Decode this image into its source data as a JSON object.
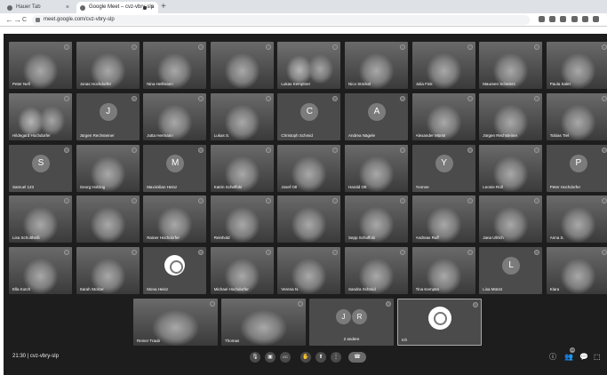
{
  "browser": {
    "tabs": [
      {
        "label": "Hauer Tab",
        "active": false
      },
      {
        "label": "Google Meet – cvz-vbry-slp",
        "active": true
      }
    ],
    "new_tab_glyph": "+",
    "close_glyph": "×",
    "url": "meet.google.com/cvz-vbry-slp",
    "back_glyph": "←",
    "forward_glyph": "→",
    "reload_glyph": "C"
  },
  "participants": [
    {
      "name": "Peter Nell",
      "kind": "photo"
    },
    {
      "name": "Jonas Hochdorfer",
      "kind": "photo"
    },
    {
      "name": "Nina Hellmann",
      "kind": "photo"
    },
    {
      "name": "",
      "kind": "photo"
    },
    {
      "name": "Lukas Kemptner",
      "kind": "photo2"
    },
    {
      "name": "Nico Stöckel",
      "kind": "photo"
    },
    {
      "name": "Julia Fink",
      "kind": "photo"
    },
    {
      "name": "Maureen Scheiers",
      "kind": "photo"
    },
    {
      "name": "Paula Saler",
      "kind": "photo"
    },
    {
      "name": "Hildegard Hochdorfer",
      "kind": "photo2"
    },
    {
      "name": "Jürgen Rechsteiner",
      "kind": "avatar",
      "initial": "J"
    },
    {
      "name": "Jutta Hermann",
      "kind": "photo"
    },
    {
      "name": "Lukas S.",
      "kind": "photo"
    },
    {
      "name": "Christoph Schmid",
      "kind": "avatar",
      "initial": "C"
    },
    {
      "name": "Andrea Nägele",
      "kind": "avatar",
      "initial": "A"
    },
    {
      "name": "Alexander Münst",
      "kind": "photo"
    },
    {
      "name": "Jürgen Rechsteiner",
      "kind": "photo"
    },
    {
      "name": "Tobias Tiel",
      "kind": "photo"
    },
    {
      "name": "Samuel 123",
      "kind": "avatar",
      "initial": "S"
    },
    {
      "name": "Georg Holzing",
      "kind": "photo"
    },
    {
      "name": "Maximilian Heinz",
      "kind": "avatar",
      "initial": "M"
    },
    {
      "name": "Katrin Scheffold",
      "kind": "photo"
    },
    {
      "name": "Josef Ott",
      "kind": "photo"
    },
    {
      "name": "Harald Ott",
      "kind": "photo"
    },
    {
      "name": "Yvonne",
      "kind": "avatar",
      "initial": "Y"
    },
    {
      "name": "Leonie Roll",
      "kind": "photo"
    },
    {
      "name": "Peter Hochdorfer",
      "kind": "avatar",
      "initial": "P"
    },
    {
      "name": "Lisa Schultheiß",
      "kind": "photo"
    },
    {
      "name": "",
      "kind": "photo"
    },
    {
      "name": "Rainer Hochdorfer",
      "kind": "photo"
    },
    {
      "name": "Reinhold",
      "kind": "photo"
    },
    {
      "name": "",
      "kind": "photo"
    },
    {
      "name": "Sepp Schoffold",
      "kind": "photo"
    },
    {
      "name": "Andreas Ruff",
      "kind": "photo"
    },
    {
      "name": "Jana Ullrich",
      "kind": "photo"
    },
    {
      "name": "Anna S.",
      "kind": "photo"
    },
    {
      "name": "Ella Kutch",
      "kind": "photo"
    },
    {
      "name": "Sarah Stolzer",
      "kind": "photo"
    },
    {
      "name": "Mona Heinz",
      "kind": "logo"
    },
    {
      "name": "Michael Hochdorfer",
      "kind": "photo"
    },
    {
      "name": "Verena N.",
      "kind": "photo"
    },
    {
      "name": "Sandra Schmid",
      "kind": "photo"
    },
    {
      "name": "Tina Kempter",
      "kind": "photo"
    },
    {
      "name": "Lisa Münst",
      "kind": "avatar",
      "initial": "L"
    },
    {
      "name": "Klara",
      "kind": "photo"
    }
  ],
  "bottom_row": [
    {
      "name": "Reiner Traub",
      "kind": "photo"
    },
    {
      "name": "Thomas",
      "kind": "photo"
    },
    {
      "name": "2 andere",
      "kind": "group",
      "initials": [
        "J",
        "R"
      ]
    },
    {
      "name": "Ich",
      "kind": "logo",
      "selected": true
    }
  ],
  "call": {
    "time": "21:30",
    "separator": "|",
    "code": "cvz-vbry-slp"
  },
  "controls": {
    "mic_glyph": "🎙",
    "cam_glyph": "▣",
    "captions_glyph": "CC",
    "hand_glyph": "✋",
    "present_glyph": "⬆",
    "more_glyph": "⋮",
    "end_glyph": "☎",
    "participant_count": "49"
  },
  "colors": {
    "meet_bg": "#1d1d1d",
    "tile_bg": "#4b4b4b",
    "avatar_bg": "#7b7b7b"
  }
}
